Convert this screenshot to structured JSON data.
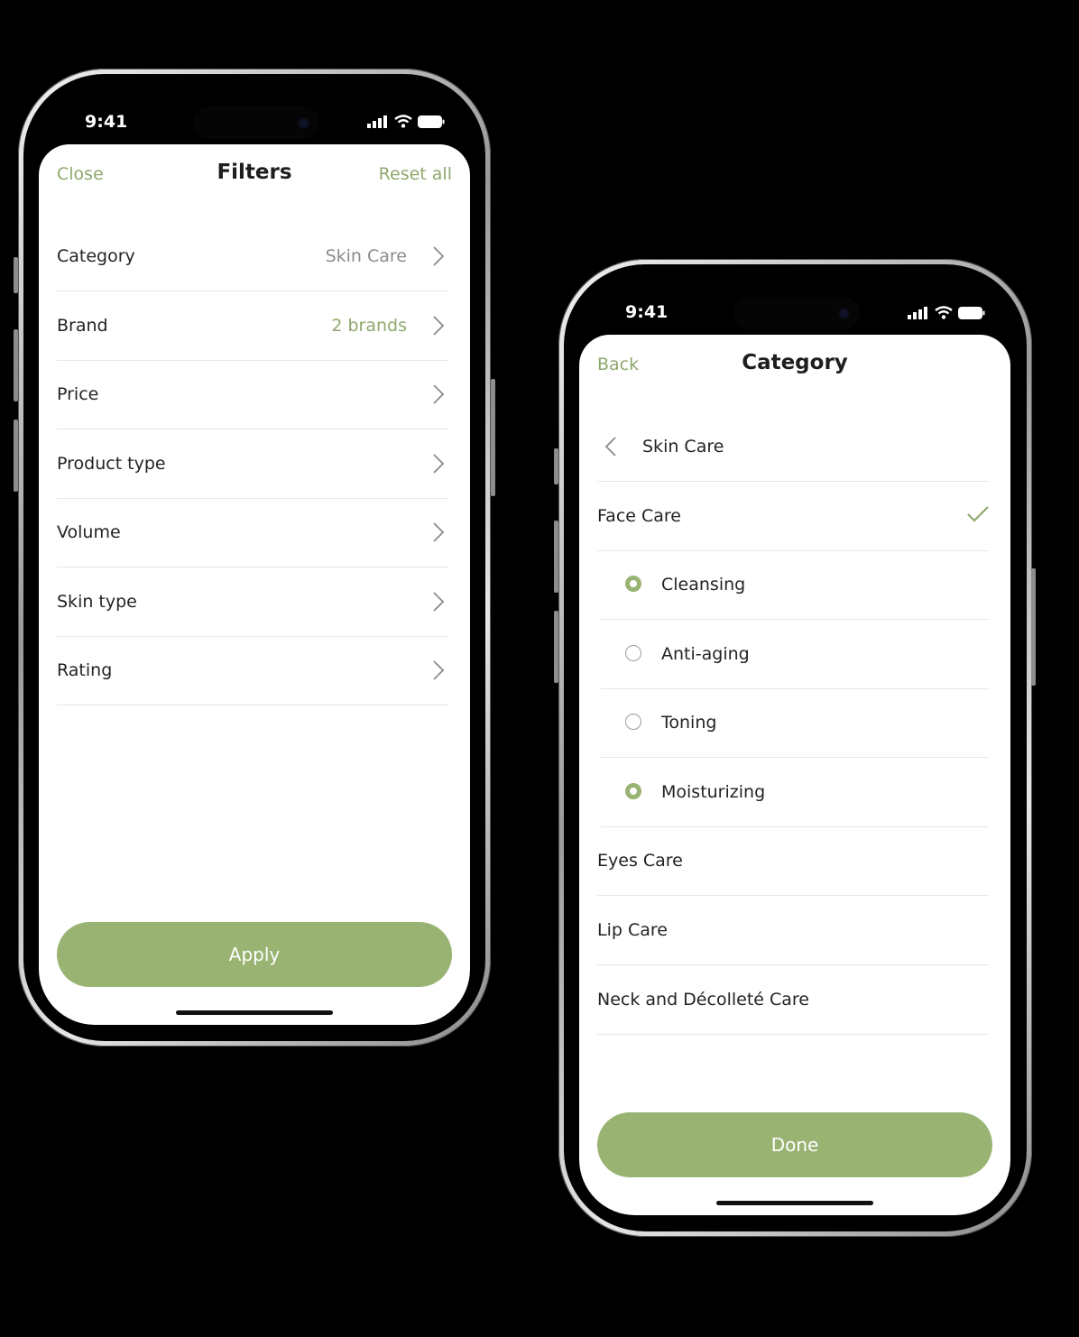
{
  "colors": {
    "accent": "#99b373",
    "accent_text": "#8fa86e",
    "background": "#000000"
  },
  "phone1": {
    "status": {
      "time": "9:41"
    },
    "nav": {
      "left": "Close",
      "title": "Filters",
      "right": "Reset all"
    },
    "rows": [
      {
        "label": "Category",
        "value": "Skin Care",
        "value_style": "grey"
      },
      {
        "label": "Brand",
        "value": "2 brands",
        "value_style": "green"
      },
      {
        "label": "Price",
        "value": ""
      },
      {
        "label": "Product type",
        "value": ""
      },
      {
        "label": "Volume",
        "value": ""
      },
      {
        "label": "Skin type",
        "value": ""
      },
      {
        "label": "Rating",
        "value": ""
      }
    ],
    "button": "Apply"
  },
  "phone2": {
    "status": {
      "time": "9:41"
    },
    "nav": {
      "left": "Back",
      "title": "Category"
    },
    "parent": "Skin Care",
    "selected_group": "Face Care",
    "options": [
      {
        "label": "Cleansing",
        "selected": true
      },
      {
        "label": "Anti-aging",
        "selected": false
      },
      {
        "label": "Toning",
        "selected": false
      },
      {
        "label": "Moisturizing",
        "selected": true
      }
    ],
    "other_groups": [
      "Eyes Care",
      "Lip Care",
      "Neck and Décolleté Care"
    ],
    "button": "Done"
  }
}
